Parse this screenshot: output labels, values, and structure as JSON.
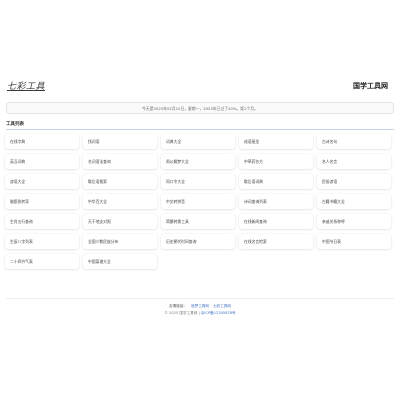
{
  "header": {
    "logo_text": "七彩工具",
    "site_title": "国学工具网"
  },
  "notice": "今天是2025年02月10日，星期一，2025年已过了40%。距2个月。",
  "section": {
    "title": "工具列表"
  },
  "tools": [
    "在线字典",
    "找词语",
    "词典大全",
    "成语接龙",
    "古诗名句",
    "英汉词典",
    "名词语法查询",
    "周公解梦大全",
    "中草药名方",
    "名人名言",
    "谚语大全",
    "歇后语搜索",
    "同口令大全",
    "歇后语词典",
    "民俗谚语",
    "脑筋急转弯",
    "中华百大全",
    "中文转拼音",
    "诗词查询列表",
    "古籍书籍大全",
    "生肖五行查询",
    "天干地支对照",
    "简繁转换工具",
    "在线新闻查询",
    "亲戚关系称呼",
    "生辰八字列表",
    "全国少数民族分布",
    "历史朝代时间查询",
    "在线名言检索",
    "中国节日表",
    "二十四节气表",
    "中国菜谱大全"
  ],
  "footer": {
    "links_label": "友情链接：",
    "links": [
      "追梦工具网",
      "七彩工具网"
    ],
    "copyright": "© 2025 国学工具网 |",
    "icp": "京ICP备12345678号"
  }
}
